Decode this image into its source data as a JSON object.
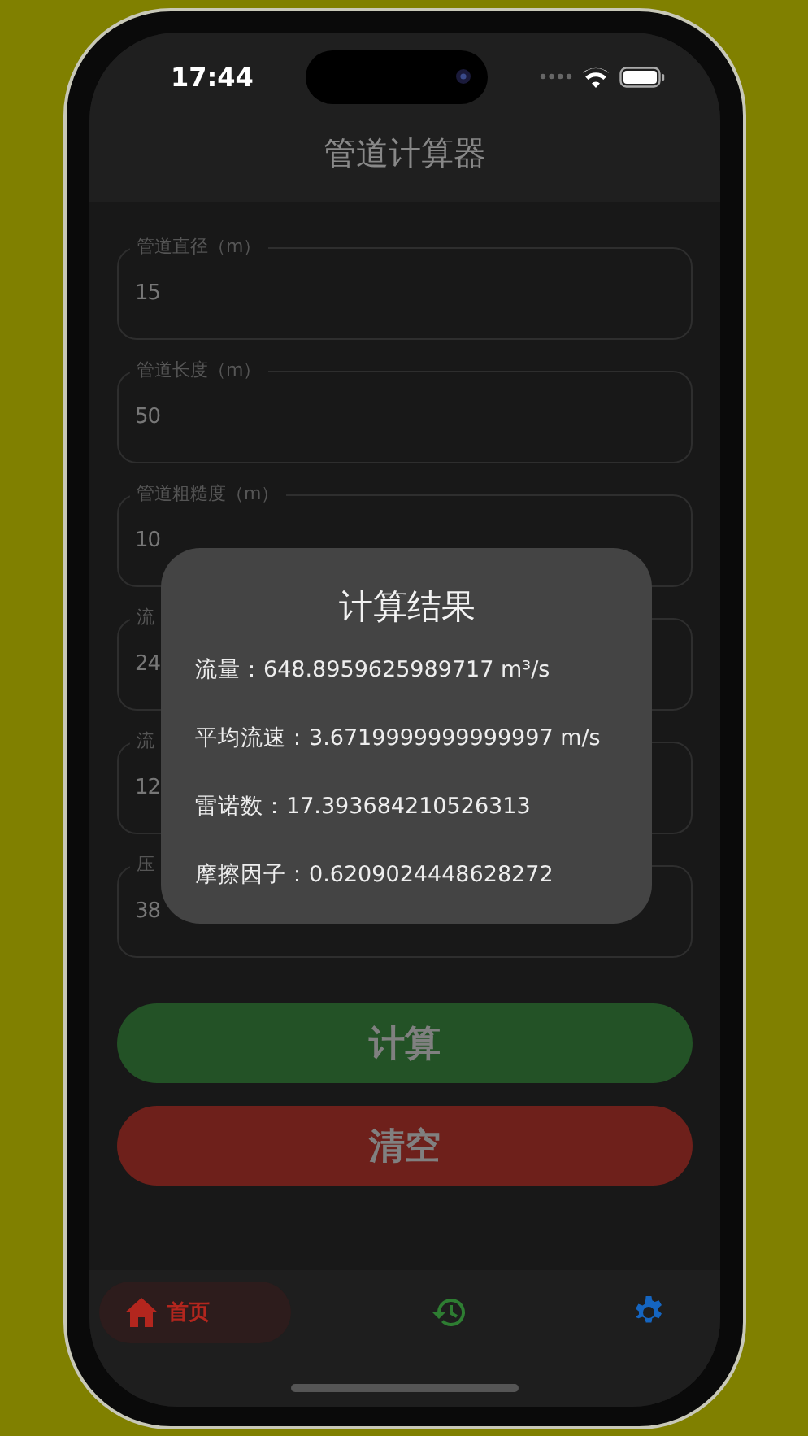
{
  "status_bar": {
    "time": "17:44"
  },
  "header": {
    "title": "管道计算器"
  },
  "fields": [
    {
      "label": "管道直径（m）",
      "value": "15"
    },
    {
      "label": "管道长度（m）",
      "value": "50"
    },
    {
      "label": "管道粗糙度（m）",
      "value": "10"
    },
    {
      "label": "流",
      "value": "24"
    },
    {
      "label": "流",
      "value": "12"
    },
    {
      "label": "压",
      "value": "38"
    }
  ],
  "buttons": [
    {
      "kind": "calculate",
      "label": "计算"
    },
    {
      "kind": "clear",
      "label": "清空"
    }
  ],
  "dialog": {
    "title": "计算结果",
    "lines": [
      "流量：648.8959625989717 m³/s",
      "平均流速：3.6719999999999997 m/s",
      "雷诺数：17.393684210526313",
      "摩擦因子：0.6209024448628272"
    ]
  },
  "bottom_nav": [
    {
      "kind": "home",
      "label": "首页",
      "selected": true,
      "color": "#b3261e"
    },
    {
      "kind": "history",
      "selected": false,
      "color": "#2e7d32"
    },
    {
      "kind": "settings",
      "selected": false,
      "color": "#1565c0"
    }
  ]
}
